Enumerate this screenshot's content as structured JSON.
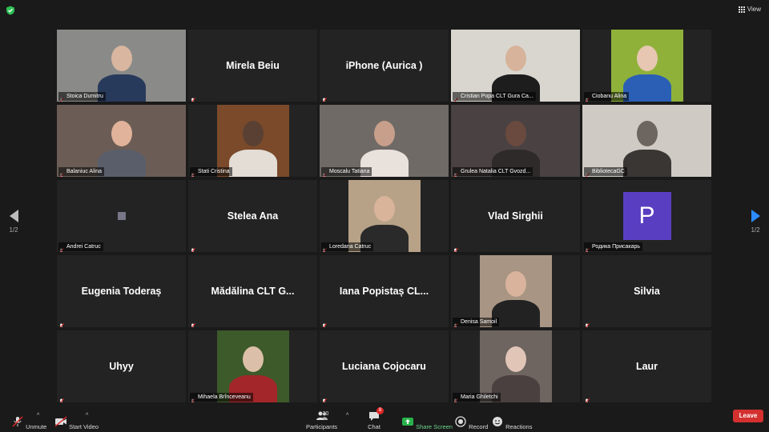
{
  "top": {
    "view_label": "View"
  },
  "nav": {
    "page_left": "1/2",
    "page_right": "1/2"
  },
  "participants": [
    {
      "label": "Stoica Dumitru",
      "active": true,
      "video": true,
      "bg": "#8a8a88",
      "skin": "#d8b6a0",
      "cloth": "#283a5c"
    },
    {
      "label": "",
      "name": "Mirela Beiu",
      "video": false
    },
    {
      "label": "",
      "name": "iPhone (Aurica )",
      "video": false
    },
    {
      "label": "Cristian Popa CLT Gura Ca...",
      "video": true,
      "bg": "#d9d6cf",
      "skin": "#d6b39a",
      "cloth": "#1d1d1d"
    },
    {
      "label": "Ciobanu Alina",
      "video": true,
      "bg": "#8fb13a",
      "skin": "#e7c7b2",
      "cloth": "#2b5fb5"
    },
    {
      "label": "Balaniuc Alina",
      "video": true,
      "bg": "#6b5d55",
      "skin": "#e0b39a",
      "cloth": "#5a5e6a"
    },
    {
      "label": "Stati Cristina",
      "video": true,
      "bg": "#7b4a2a",
      "skin": "#5a4032",
      "cloth": "#e3ddd6"
    },
    {
      "label": "Moscalu Tatiana",
      "video": true,
      "bg": "#6f6a66",
      "skin": "#c79f8a",
      "cloth": "#e8e1dc"
    },
    {
      "label": "Grulea Natalia CLT Gvozd...",
      "video": true,
      "bg": "#4a4242",
      "skin": "#6a4a3f",
      "cloth": "#2e2a2a"
    },
    {
      "label": "BibliotecaGC",
      "video": true,
      "bg": "#cfcac4",
      "skin": "#6c6560",
      "cloth": "#3a3633"
    },
    {
      "label": "Andrei Catruc",
      "square": true,
      "video": false
    },
    {
      "label": "",
      "name": "Stelea Ana",
      "video": false
    },
    {
      "label": "Loredana Catruc",
      "video": true,
      "bg": "#b7a288",
      "skin": "#d9b49b",
      "cloth": "#2a2a2a"
    },
    {
      "label": "",
      "name": "Vlad Sirghii",
      "video": false
    },
    {
      "label": "Родика Присакарь",
      "avatar": "P",
      "video": false
    },
    {
      "label": "",
      "name": "Eugenia Toderaș",
      "video": false
    },
    {
      "label": "",
      "name": "Mădălina CLT G...",
      "video": false
    },
    {
      "label": "",
      "name": "Iana Popistaș CL...",
      "video": false
    },
    {
      "label": "Denisa Samoil",
      "video": true,
      "bg": "#a89584",
      "skin": "#d9b39c",
      "cloth": "#222"
    },
    {
      "label": "",
      "name": "Silvia",
      "video": false
    },
    {
      "label": "",
      "name": "Uhyy",
      "video": false
    },
    {
      "label": "Mihaela Brînceveanu",
      "video": true,
      "bg": "#3d5a2a",
      "skin": "#dcbfa8",
      "cloth": "#a2262a"
    },
    {
      "label": "",
      "name": "Luciana Cojocaru",
      "video": false
    },
    {
      "label": "Maria Ghiletchi",
      "video": true,
      "bg": "#6e6460",
      "skin": "#e1c6b8",
      "cloth": "#4a4040"
    },
    {
      "label": "",
      "name": "Laur",
      "video": false
    }
  ],
  "toolbar": {
    "unmute": "Unmute",
    "start_video": "Start Video",
    "participants": "Participants",
    "participants_count": "30",
    "chat": "Chat",
    "chat_badge": "8",
    "share": "Share Screen",
    "record": "Record",
    "reactions": "Reactions",
    "leave": "Leave"
  },
  "colors": {
    "accent": "#2d8cff",
    "active_border": "#c6e05b",
    "leave": "#d3302f",
    "share": "#28b24b"
  }
}
